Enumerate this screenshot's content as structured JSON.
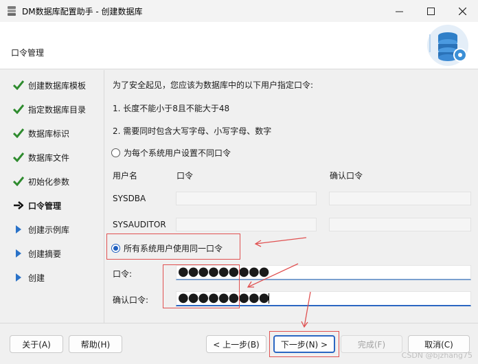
{
  "window": {
    "title": "DM数据库配置助手 - 创建数据库"
  },
  "header": {
    "title": "口令管理"
  },
  "steps": [
    {
      "label": "创建数据库模板",
      "state": "done"
    },
    {
      "label": "指定数据库目录",
      "state": "done"
    },
    {
      "label": "数据库标识",
      "state": "done"
    },
    {
      "label": "数据库文件",
      "state": "done"
    },
    {
      "label": "初始化参数",
      "state": "done"
    },
    {
      "label": "口令管理",
      "state": "current"
    },
    {
      "label": "创建示例库",
      "state": "pending"
    },
    {
      "label": "创建摘要",
      "state": "pending"
    },
    {
      "label": "创建",
      "state": "pending"
    }
  ],
  "main": {
    "intro": "为了安全起见，您应该为数据库中的以下用户指定口令:",
    "rule1": "1. 长度不能小于8且不能大于48",
    "rule2": "2. 需要同时包含大写字母、小写字母、数字",
    "radio_individual": "为每个系统用户设置不同口令",
    "col_user": "用户名",
    "col_password": "口令",
    "col_confirm": "确认口令",
    "users": [
      "SYSDBA",
      "SYSAUDITOR"
    ],
    "radio_same": "所有系统用户使用同一口令",
    "password_label": "口令:",
    "password_value": "●●●●●●●●●",
    "confirm_label": "确认口令:",
    "confirm_value": "●●●●●●●●●"
  },
  "buttons": {
    "about": "关于(A)",
    "help": "帮助(H)",
    "prev": "< 上一步(B)",
    "next": "下一步(N) >",
    "finish": "完成(F)",
    "cancel": "取消(C)"
  },
  "watermark": "CSDN @bjzhang75",
  "colors": {
    "accent": "#2a66c2",
    "check": "#2e8b2e",
    "annotation": "#e05050"
  }
}
